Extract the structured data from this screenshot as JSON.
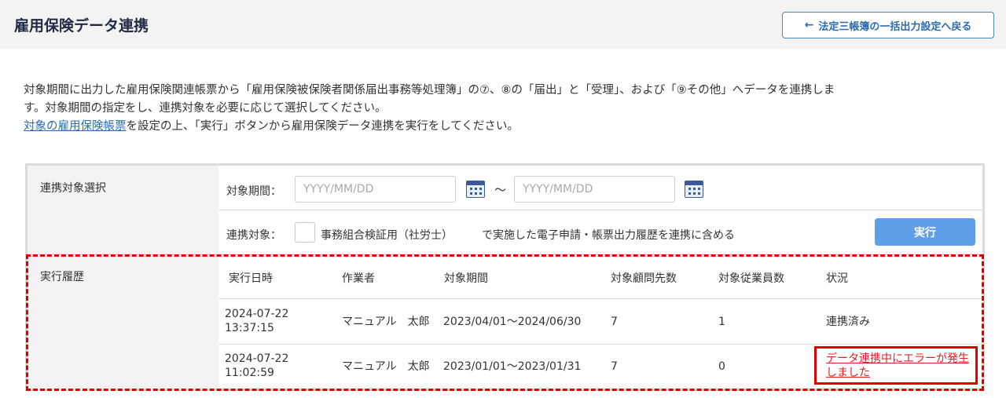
{
  "header": {
    "title": "雇用保険データ連携",
    "back_label": "法定三帳簿の一括出力設定へ戻る"
  },
  "description": {
    "line1": "対象期間に出力した雇用保険関連帳票から「雇用保険被保険者関係届出事務等処理簿」の⑦、⑧の「届出」と「受理」、および「⑨その他」へデータを連携しま",
    "line2": "す。対象期間の指定をし、連携対象を必要に応じて選択してください。",
    "link": "対象の雇用保険帳票",
    "line3_rest": "を設定の上、「実行」ボタンから雇用保険データ連携を実行をしてください。"
  },
  "selection": {
    "section_label": "連携対象選択",
    "period_label": "対象期間：",
    "from_placeholder": "YYYY/MM/DD",
    "tilde": "～",
    "to_placeholder": "YYYY/MM/DD",
    "target_label": "連携対象：",
    "checkbox_label": "事務組合検証用（社労士）",
    "suffix": "で実施した電子申請・帳票出力履歴を連携に含める",
    "run_label": "実行"
  },
  "history": {
    "section_label": "実行履歴",
    "columns": [
      "実行日時",
      "作業者",
      "対象期間",
      "対象顧問先数",
      "対象従業員数",
      "状況"
    ],
    "rows": [
      {
        "date": "2024-07-22",
        "time": "13:37:15",
        "operator": "マニュアル　太郎",
        "period": "2023/04/01～2024/06/30",
        "clients": "7",
        "employees": "1",
        "status": "連携済み"
      },
      {
        "date": "2024-07-22",
        "time": "11:02:59",
        "operator": "マニュアル　太郎",
        "period": "2023/01/01～2023/01/31",
        "clients": "7",
        "employees": "0",
        "status": "データ連携中にエラーが発生しました"
      }
    ]
  }
}
